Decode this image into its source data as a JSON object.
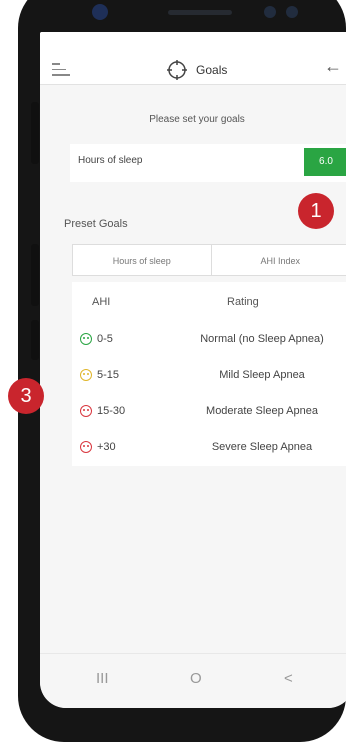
{
  "header": {
    "title": "Goals"
  },
  "intro": {
    "hint": "Please set your goals"
  },
  "goal": {
    "label": "Hours of sleep",
    "value": "6.0"
  },
  "preset": {
    "label": "Preset Goals",
    "tabs": [
      "Hours of sleep",
      "AHI Index"
    ]
  },
  "table": {
    "headers": {
      "ahi": "AHI",
      "rating": "Rating"
    },
    "rows": [
      {
        "ahi": "0-5",
        "rating": "Normal (no Sleep Apnea)",
        "color": "#2aa543"
      },
      {
        "ahi": "5-15",
        "rating": "Mild Sleep Apnea",
        "color": "#e0b62b"
      },
      {
        "ahi": "15-30",
        "rating": "Moderate Sleep Apnea",
        "color": "#d9373f"
      },
      {
        "ahi": "+30",
        "rating": "Severe Sleep Apnea",
        "color": "#d9373f"
      }
    ]
  },
  "nav": {
    "recent": "III",
    "home": "O",
    "back": "<"
  },
  "callouts": {
    "b1": "1",
    "b3": "3"
  },
  "colors": {
    "accent": "#2aa543",
    "callout": "#c9252d"
  }
}
